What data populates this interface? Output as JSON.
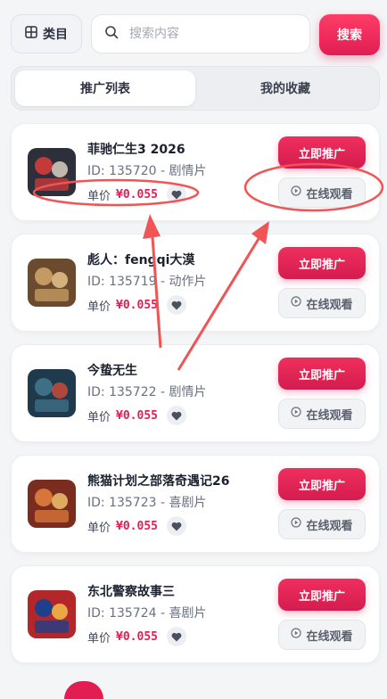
{
  "header": {
    "category_label": "类目",
    "search_placeholder": "搜索内容",
    "search_button": "搜索"
  },
  "tabs": [
    {
      "label": "推广列表",
      "active": true
    },
    {
      "label": "我的收藏",
      "active": false
    }
  ],
  "items": [
    {
      "title": "菲驰仁生3 2026",
      "meta": "ID: 135720 - 剧情片",
      "price_label": "单价",
      "price": "¥0.055",
      "promote": "立即推广",
      "watch": "在线观看",
      "poster_colors": [
        "#2d2f3b",
        "#c23a3a",
        "#d9cfc3"
      ]
    },
    {
      "title": "彪人：fengqi大漠",
      "meta": "ID: 135719 - 动作片",
      "price_label": "单价",
      "price": "¥0.055",
      "promote": "立即推广",
      "watch": "在线观看",
      "poster_colors": [
        "#6b4a2e",
        "#c49a62",
        "#e6c48a"
      ]
    },
    {
      "title": "今蛰无生",
      "meta": "ID: 135722 - 剧情片",
      "price_label": "单价",
      "price": "¥0.055",
      "promote": "立即推广",
      "watch": "在线观看",
      "poster_colors": [
        "#1f3a4d",
        "#3f6f86",
        "#c94b3a"
      ]
    },
    {
      "title": "熊猫计划之部落奇遇记26",
      "meta": "ID: 135723 - 喜剧片",
      "price_label": "单价",
      "price": "¥0.055",
      "promote": "立即推广",
      "watch": "在线观看",
      "poster_colors": [
        "#7a2c1f",
        "#d6763a",
        "#f0c36a"
      ]
    },
    {
      "title": "东北警察故事三",
      "meta": "ID: 135724 - 喜剧片",
      "price_label": "单价",
      "price": "¥0.055",
      "promote": "立即推广",
      "watch": "在线观看",
      "poster_colors": [
        "#b3262a",
        "#1e3f8a",
        "#f2c04a"
      ]
    }
  ],
  "colors": {
    "accent": "#e11d52",
    "annotation": "#f05454"
  },
  "icons": {
    "category": "grid-icon",
    "search": "search-icon",
    "favorite": "heart-icon",
    "watch": "play-circle-icon"
  }
}
